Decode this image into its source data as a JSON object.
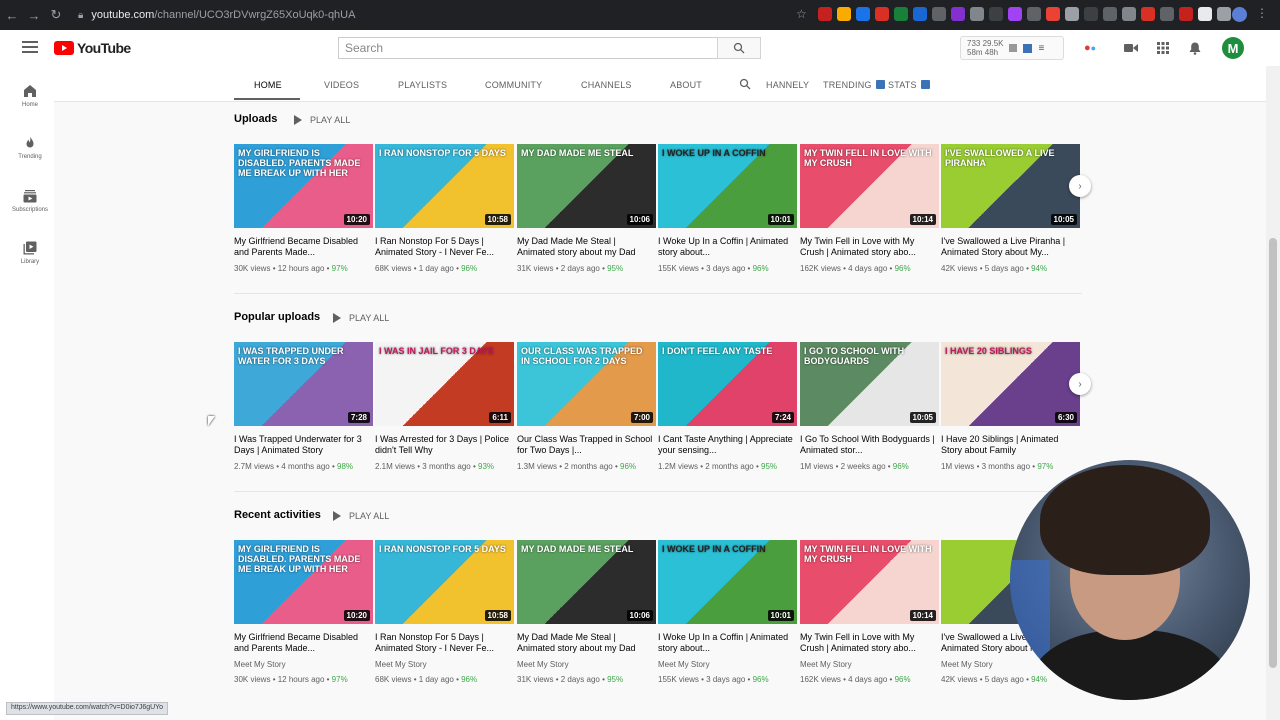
{
  "browser": {
    "url_host": "youtube.com",
    "url_path": "/channel/UCO3rDVwrgZ65XoUqk0-qhUA",
    "status_link": "https://www.youtube.com/watch?v=D0io7J6gUYo"
  },
  "header": {
    "logo_text": "YouTube",
    "search_placeholder": "Search",
    "stats_line1": "733 29.5K",
    "stats_line2": "58m 48h",
    "avatar_letter": "M"
  },
  "sidebar": {
    "items": [
      {
        "label": "Home"
      },
      {
        "label": "Trending"
      },
      {
        "label": "Subscriptions"
      },
      {
        "label": "Library"
      }
    ]
  },
  "tabs": [
    {
      "label": "HOME"
    },
    {
      "label": "VIDEOS"
    },
    {
      "label": "PLAYLISTS"
    },
    {
      "label": "COMMUNITY"
    },
    {
      "label": "CHANNELS"
    },
    {
      "label": "ABOUT"
    },
    {
      "label": "HANNELY"
    },
    {
      "label": "TRENDING"
    },
    {
      "label": "STATS"
    }
  ],
  "sections": [
    {
      "title": "Uploads",
      "play_all": "PLAY ALL",
      "videos": [
        {
          "thumb_text": "My girlfriend is disabled. Parents made me break up with her",
          "duration": "10:20",
          "title": "My Girlfriend Became Disabled and Parents Made...",
          "views": "30K views",
          "age": "12 hours ago",
          "pct": "97%"
        },
        {
          "thumb_text": "I ran nonstop for 5 days",
          "duration": "10:58",
          "title": "I Ran Nonstop For 5 Days | Animated Story - I Never Fe...",
          "views": "68K views",
          "age": "1 day ago",
          "pct": "96%"
        },
        {
          "thumb_text": "My dad made me steal",
          "duration": "10:06",
          "title": "My Dad Made Me Steal | Animated story about my Dad",
          "views": "31K views",
          "age": "2 days ago",
          "pct": "95%"
        },
        {
          "thumb_text": "I woke up in a coffin",
          "duration": "10:01",
          "title": "I Woke Up In a Coffin | Animated story about...",
          "views": "155K views",
          "age": "3 days ago",
          "pct": "96%"
        },
        {
          "thumb_text": "My twin fell in love with my crush",
          "duration": "10:14",
          "title": "My Twin Fell in Love with My Crush | Animated story abo...",
          "views": "162K views",
          "age": "4 days ago",
          "pct": "96%"
        },
        {
          "thumb_text": "I've swallowed a live piranha",
          "duration": "10:05",
          "title": "I've Swallowed a Live Piranha | Animated Story about My...",
          "views": "42K views",
          "age": "5 days ago",
          "pct": "94%"
        }
      ]
    },
    {
      "title": "Popular uploads",
      "play_all": "PLAY ALL",
      "videos": [
        {
          "thumb_text": "I was trapped under water for 3 days",
          "duration": "7:28",
          "title": "I Was Trapped Underwater for 3 Days | Animated Story",
          "views": "2.7M views",
          "age": "4 months ago",
          "pct": "98%"
        },
        {
          "thumb_text": "I was in jail for 3 days",
          "duration": "6:11",
          "title": "I Was Arrested for 3 Days | Police didn't Tell Why",
          "views": "2.1M views",
          "age": "3 months ago",
          "pct": "93%"
        },
        {
          "thumb_text": "Our class was trapped in school for 2 days",
          "duration": "7:00",
          "title": "Our Class Was Trapped in School for Two Days |...",
          "views": "1.3M views",
          "age": "2 months ago",
          "pct": "96%"
        },
        {
          "thumb_text": "I don't feel any taste",
          "duration": "7:24",
          "title": "I Cant Taste Anything | Appreciate your sensing...",
          "views": "1.2M views",
          "age": "2 months ago",
          "pct": "95%"
        },
        {
          "thumb_text": "I go to school with bodyguards",
          "duration": "10:05",
          "title": "I Go To School With Bodyguards | Animated stor...",
          "views": "1M views",
          "age": "2 weeks ago",
          "pct": "96%"
        },
        {
          "thumb_text": "I have 20 siblings",
          "duration": "6:30",
          "title": "I Have 20 Siblings | Animated Story about Family",
          "views": "1M views",
          "age": "3 months ago",
          "pct": "97%"
        }
      ]
    },
    {
      "title": "Recent activities",
      "play_all": "PLAY ALL",
      "videos": [
        {
          "thumb_text": "My girlfriend is disabled. Parents made me break up with her",
          "duration": "10:20",
          "title": "My Girlfriend Became Disabled and Parents Made...",
          "channel": "Meet My Story",
          "views": "30K views",
          "age": "12 hours ago",
          "pct": "97%"
        },
        {
          "thumb_text": "I ran nonstop for 5 days",
          "duration": "10:58",
          "title": "I Ran Nonstop For 5 Days | Animated Story - I Never Fe...",
          "channel": "Meet My Story",
          "views": "68K views",
          "age": "1 day ago",
          "pct": "96%"
        },
        {
          "thumb_text": "My dad made me steal",
          "duration": "10:06",
          "title": "My Dad Made Me Steal | Animated story about my Dad",
          "channel": "Meet My Story",
          "views": "31K views",
          "age": "2 days ago",
          "pct": "95%"
        },
        {
          "thumb_text": "I woke up in a coffin",
          "duration": "10:01",
          "title": "I Woke Up In a Coffin | Animated story about...",
          "channel": "Meet My Story",
          "views": "155K views",
          "age": "3 days ago",
          "pct": "96%"
        },
        {
          "thumb_text": "My twin fell in love with my crush",
          "duration": "10:14",
          "title": "My Twin Fell in Love with My Crush | Animated story abo...",
          "channel": "Meet My Story",
          "views": "162K views",
          "age": "4 days ago",
          "pct": "96%"
        },
        {
          "thumb_text": "",
          "duration": "",
          "title": "I've Swallowed a Live Piranha | Animated Story about My...",
          "channel": "Meet My Story",
          "views": "42K views",
          "age": "5 days ago",
          "pct": "94%"
        }
      ]
    }
  ],
  "colors": {
    "accent_red": "#ff0000",
    "pct_green": "#3ea84a"
  }
}
